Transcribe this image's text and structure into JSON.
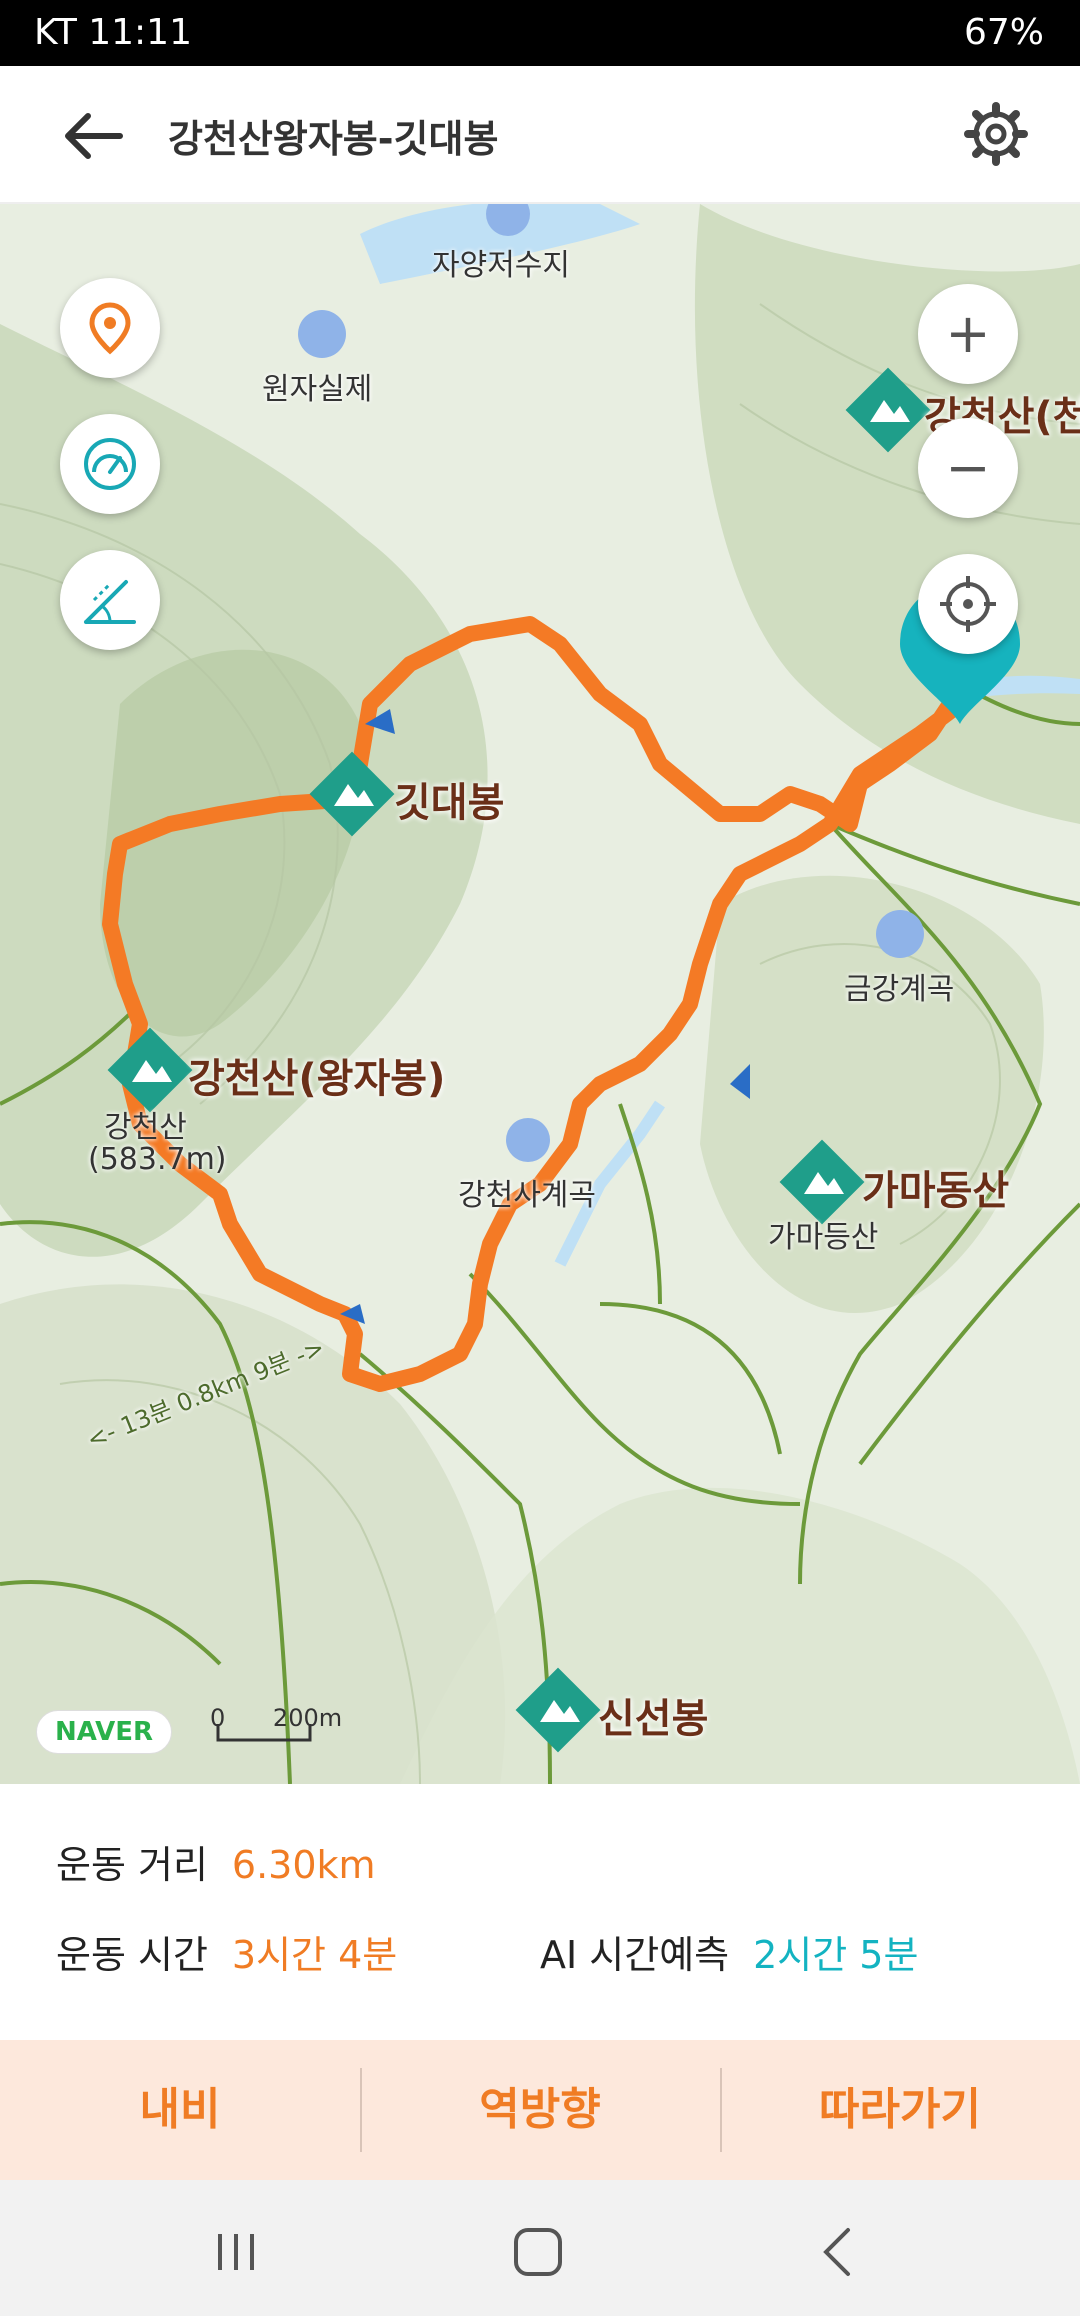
{
  "status_bar": {
    "carrier_time": "KT 11:11",
    "battery": "67%",
    "left_icons": [
      "b-icon",
      "c-icon",
      "feather-icon",
      "dot-icon"
    ],
    "right_icons": [
      "alarm-icon",
      "location-icon",
      "hd-icon",
      "5g-icon",
      "signal-icon",
      "battery-icon"
    ]
  },
  "header": {
    "title": "강천산왕자봉-깃대봉",
    "back_icon": "arrow-left-icon",
    "settings_icon": "gear-icon"
  },
  "map": {
    "places": {
      "reservoir": "자양저수지",
      "wonjasilje": "원자실제",
      "gitdaebong": "깃대봉",
      "wangjabong": "강천산(왕자봉)",
      "gangcheonsan_small": "강천산",
      "gangcheonsan_height": "(583.7m)",
      "geumgang": "금강계곡",
      "gamadongsan": "가마동산",
      "gamadeungsan": "가마등산",
      "gangcheonsa": "강천사계곡",
      "sinseonbong": "신선봉",
      "right_edge_peak": "강천산(천",
      "trail_info": "<- 13분 0.8km 9분 ->"
    },
    "controls": {
      "location_pin": "location-pin-icon",
      "speedometer": "speedometer-icon",
      "slope": "slope-icon",
      "zoom_in": "+",
      "zoom_out": "−",
      "crosshair": "crosshair-icon"
    },
    "logo": "NAVER",
    "scale_zero": "0",
    "scale_label": "200m",
    "colors": {
      "route": "#f47a25",
      "trail": "#6c9a3a",
      "water": "#bfe0f5",
      "peak_marker": "#1f9e8a"
    }
  },
  "stats": {
    "distance_label": "운동 거리",
    "distance_value": "6.30km",
    "time_label": "운동 시간",
    "time_value": "3시간 4분",
    "ai_label": "AI 시간예측",
    "ai_value": "2시간 5분"
  },
  "actions": {
    "navi": "내비",
    "reverse": "역방향",
    "follow": "따라가기"
  },
  "system_nav": {
    "recent": "recent-apps-icon",
    "home": "home-icon",
    "back": "back-icon"
  }
}
